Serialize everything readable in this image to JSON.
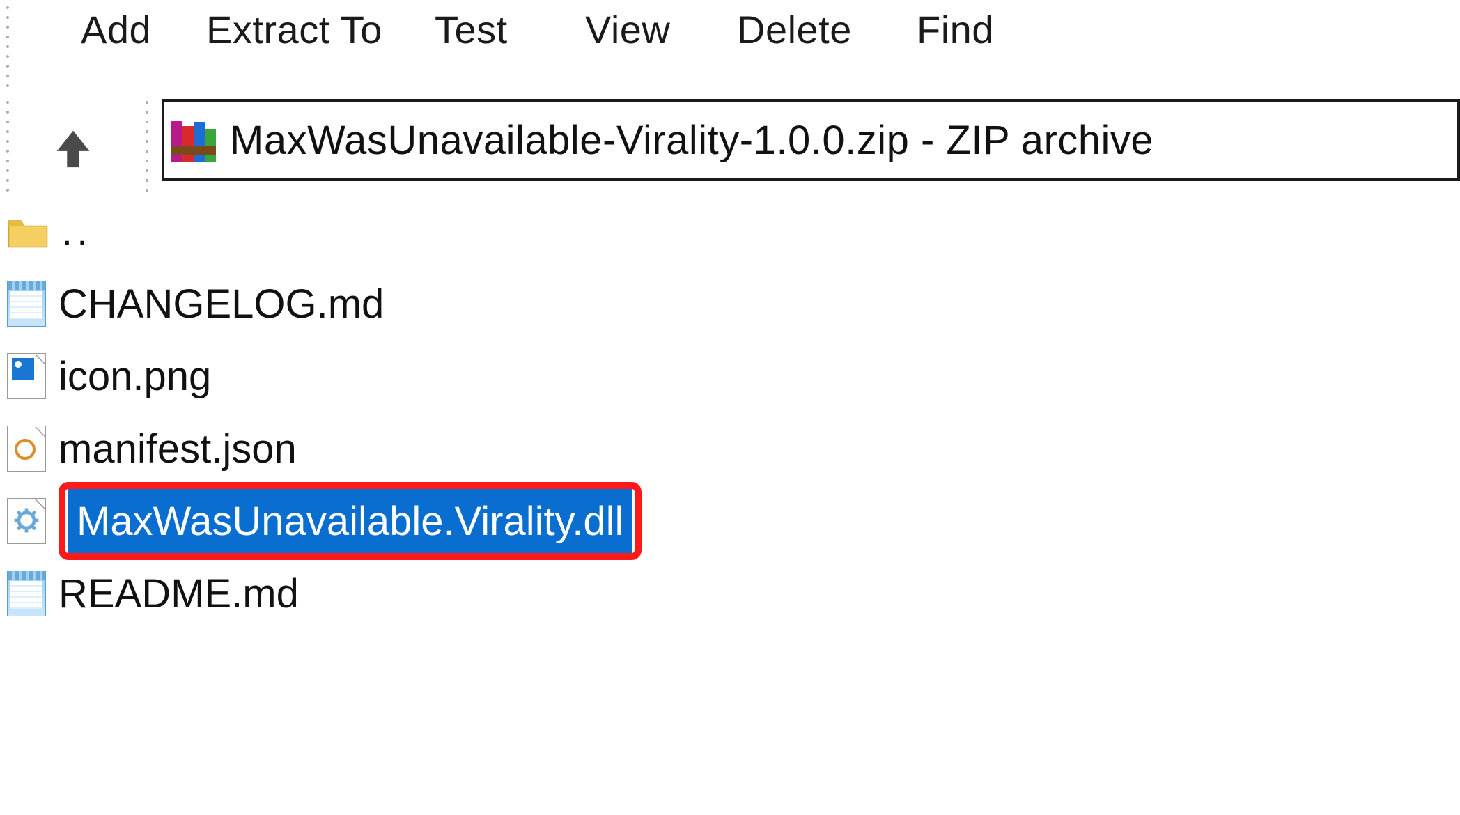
{
  "toolbar": {
    "add": "Add",
    "extract": "Extract To",
    "test": "Test",
    "view": "View",
    "delete": "Delete",
    "find": "Find"
  },
  "address": {
    "path": "MaxWasUnavailable-Virality-1.0.0.zip - ZIP archive"
  },
  "files": {
    "parent": "..",
    "changelog": "CHANGELOG.md",
    "icon": "icon.png",
    "manifest": "manifest.json",
    "dll": "MaxWasUnavailable.Virality.dll",
    "readme": "README.md"
  }
}
